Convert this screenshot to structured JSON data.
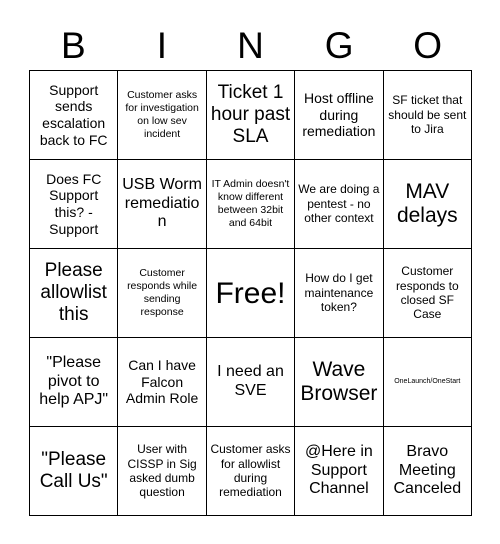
{
  "card": {
    "header_letters": [
      "B",
      "I",
      "N",
      "G",
      "O"
    ],
    "rows": [
      [
        {
          "text": "Support sends escalation back to FC",
          "size": "fs-m"
        },
        {
          "text": "Customer asks for investigation on low sev incident",
          "size": "fs-xs"
        },
        {
          "text": "Ticket 1 hour past SLA",
          "size": "fs-xl"
        },
        {
          "text": "Host offline during remediation",
          "size": "fs-m"
        },
        {
          "text": "SF ticket that should be sent to Jira",
          "size": "fs-s"
        }
      ],
      [
        {
          "text": "Does FC Support this? - Support",
          "size": "fs-m"
        },
        {
          "text": "USB Worm remediation",
          "size": "fs-l"
        },
        {
          "text": "IT Admin doesn't know different between 32bit and 64bit",
          "size": "fs-xs"
        },
        {
          "text": "We are doing a pentest - no other context",
          "size": "fs-s"
        },
        {
          "text": "MAV delays",
          "size": "fs-xxl"
        }
      ],
      [
        {
          "text": "Please allowlist this",
          "size": "fs-xl"
        },
        {
          "text": "Customer responds while sending response",
          "size": "fs-xs"
        },
        {
          "text": "Free!",
          "size": "fs-free"
        },
        {
          "text": "How do I get maintenance token?",
          "size": "fs-s"
        },
        {
          "text": "Customer responds to closed SF Case",
          "size": "fs-s"
        }
      ],
      [
        {
          "text": "\"Please pivot to help APJ\"",
          "size": "fs-l"
        },
        {
          "text": "Can I have Falcon Admin Role",
          "size": "fs-m"
        },
        {
          "text": "I need an SVE",
          "size": "fs-l"
        },
        {
          "text": "Wave Browser",
          "size": "fs-xxl"
        },
        {
          "text": "OneLaunch/OneStart",
          "size": "fs-xxs"
        }
      ],
      [
        {
          "text": "\"Please Call Us\"",
          "size": "fs-xl"
        },
        {
          "text": "User with CISSP in Sig asked dumb question",
          "size": "fs-s"
        },
        {
          "text": "Customer asks for allowlist during remediation",
          "size": "fs-s"
        },
        {
          "text": "@Here in Support Channel",
          "size": "fs-l"
        },
        {
          "text": "Bravo Meeting Canceled",
          "size": "fs-l"
        }
      ]
    ]
  }
}
